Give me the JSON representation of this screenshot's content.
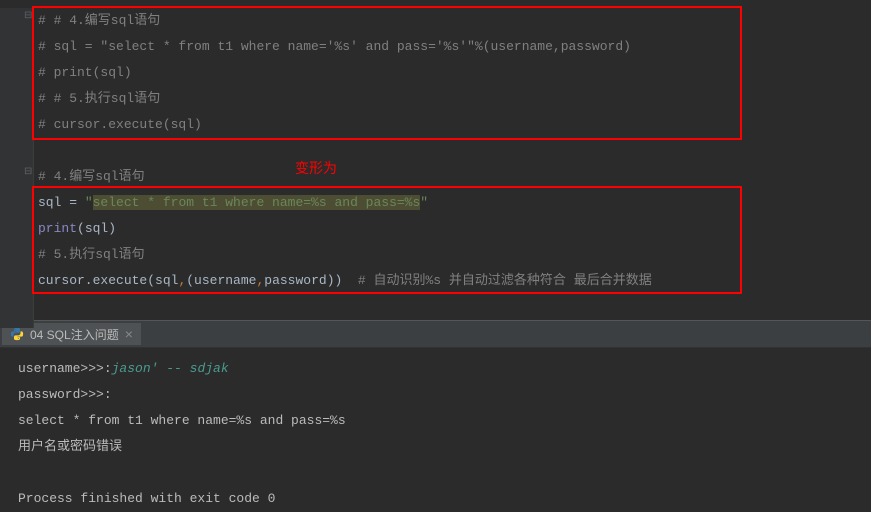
{
  "editor": {
    "lines": {
      "l1": "# # 4.编写sql语句",
      "l2_prefix": "# sql = ",
      "l2_string": "\"select * from t1 where name='%s' and pass='%s'\"",
      "l2_suffix": "%(username,password)",
      "l3": "# print(sql)",
      "l4": "# # 5.执行sql语句",
      "l5": "# cursor.execute(sql)",
      "transform_label": "变形为",
      "l7": "# 4.编写sql语句",
      "l8_var": "sql = ",
      "l8_q1": "\"",
      "l8_hl": "select * from t1 where name=%s and pass=%s",
      "l8_q2": "\"",
      "l9_func": "print",
      "l9_args": "(sql)",
      "l10": "# 5.执行sql语句",
      "l11_obj": "cursor.execute(sql",
      "l11_comma": ",",
      "l11_tuple": "(username",
      "l11_comma2": ",",
      "l11_pwd": "password))",
      "l11_comment": "  # 自动识别%s 并自动过滤各种符合 最后合并数据"
    }
  },
  "tab": {
    "title": "04 SQL注入问题"
  },
  "console": {
    "l1_prompt": "username>>>:",
    "l1_input": "jason' -- sdjak",
    "l2": "password>>>:",
    "l3": "select * from t1 where name=%s and pass=%s",
    "l4": "用户名或密码错误",
    "l5": "Process finished with exit code 0"
  }
}
